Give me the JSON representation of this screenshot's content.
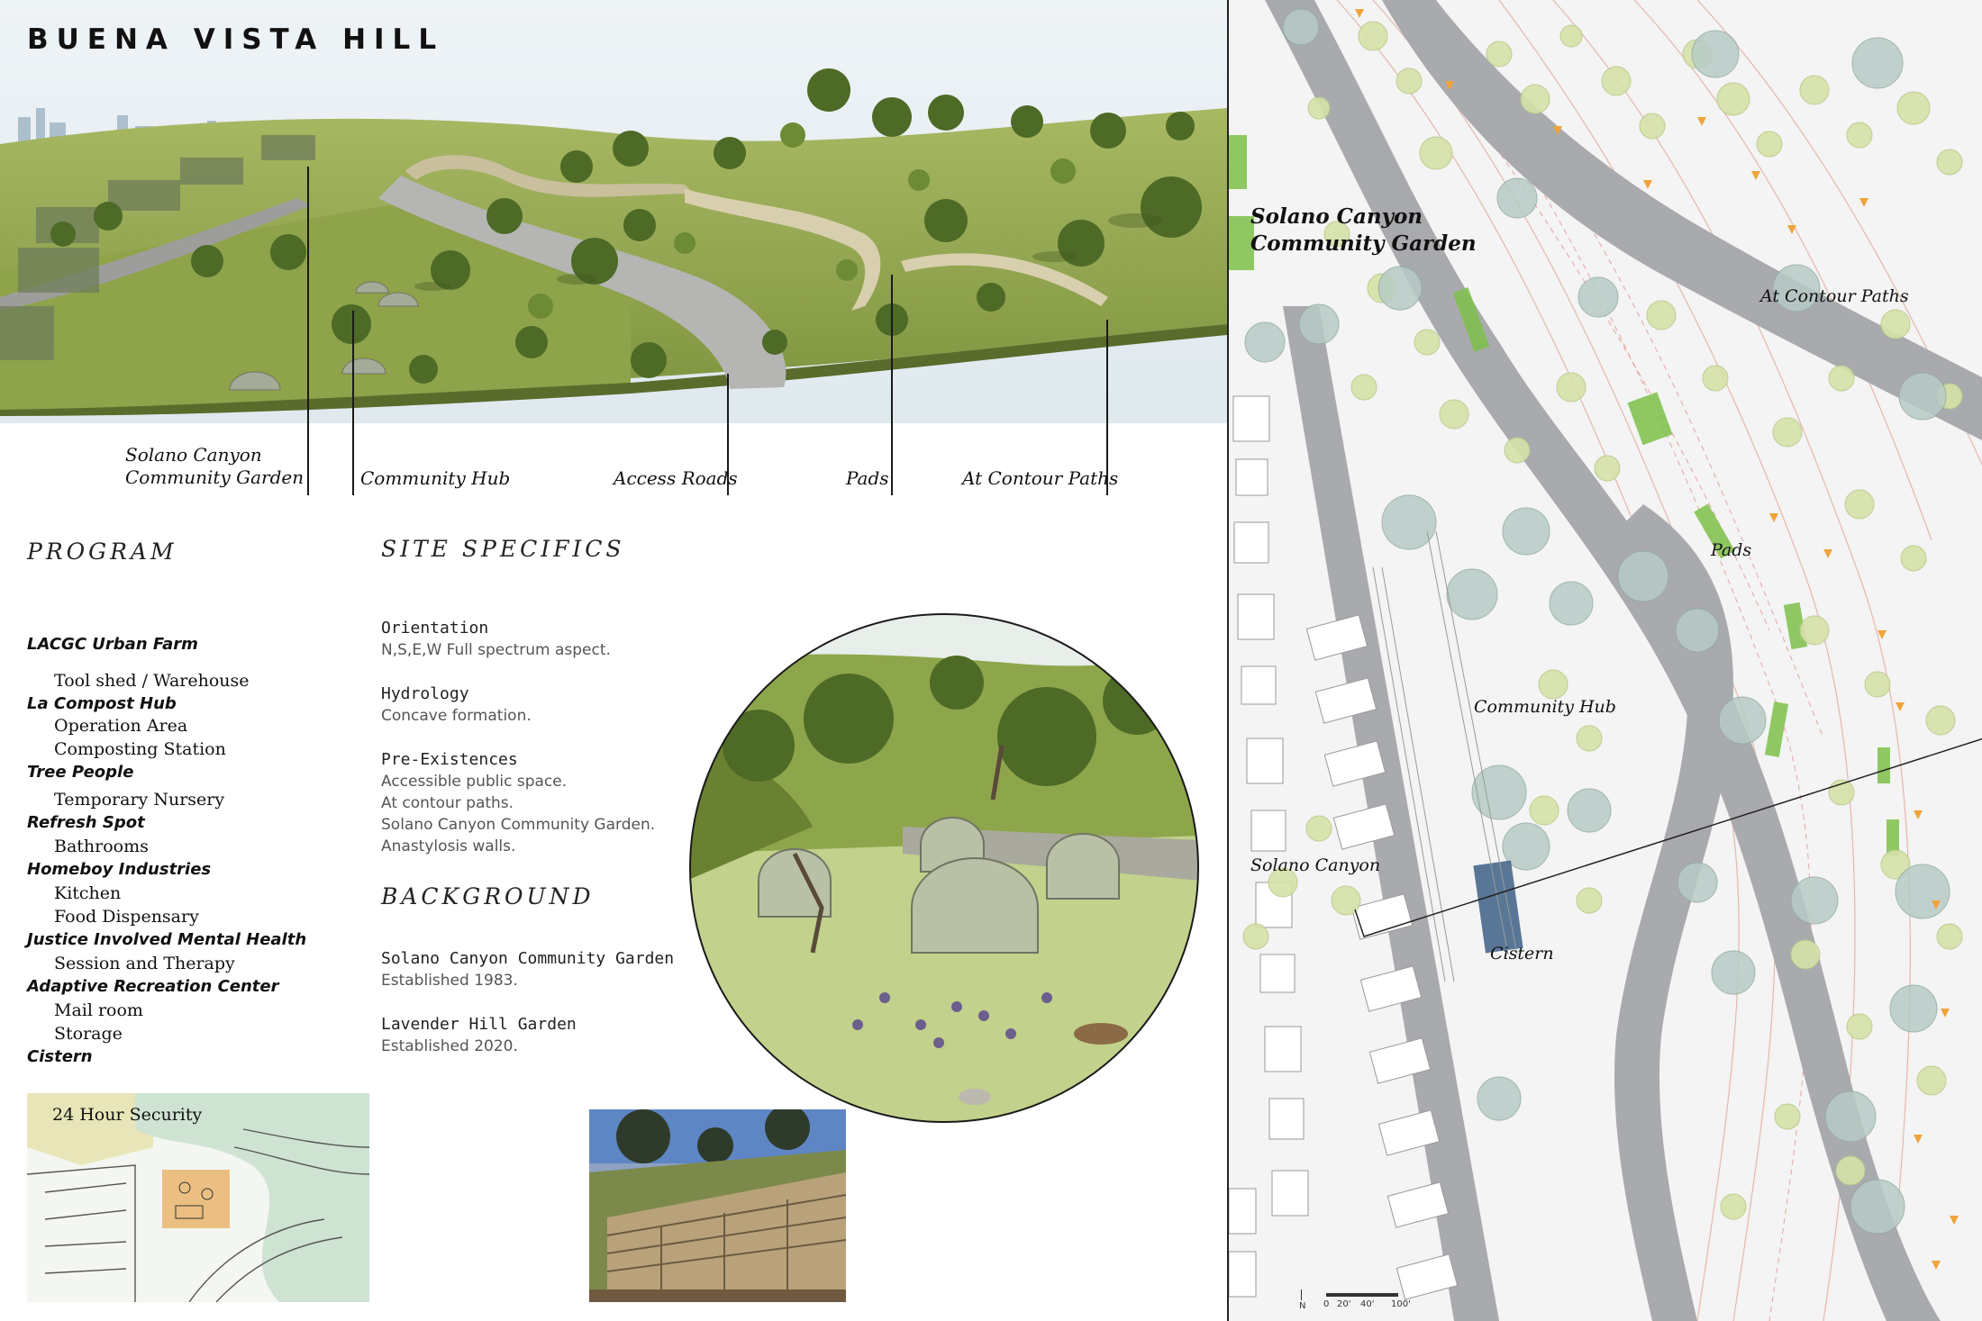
{
  "title": "BUENA VISTA HILL",
  "render_callouts": [
    {
      "label": "Solano Canyon\nCommunity Garden"
    },
    {
      "label": "Community Hub"
    },
    {
      "label": "Access Roads"
    },
    {
      "label": "Pads"
    },
    {
      "label": "At Contour Paths"
    }
  ],
  "program": {
    "heading": "PROGRAM",
    "groups": [
      {
        "name": "LACGC Urban Farm",
        "items": [
          "Tool shed / Warehouse"
        ]
      },
      {
        "name": "La Compost Hub",
        "items": [
          "Operation Area",
          "Composting Station"
        ]
      },
      {
        "name": "Tree People",
        "items": [
          "Temporary Nursery"
        ]
      },
      {
        "name": "Refresh Spot",
        "items": [
          "Bathrooms"
        ]
      },
      {
        "name": "Homeboy Industries",
        "items": [
          "Kitchen",
          "Food Dispensary"
        ]
      },
      {
        "name": "Justice Involved Mental Health",
        "items": [
          "Session and Therapy"
        ]
      },
      {
        "name": "Adaptive Recreation Center",
        "items": [
          "Mail room",
          "Storage"
        ]
      },
      {
        "name": "Cistern",
        "items": []
      }
    ]
  },
  "site_specifics": {
    "heading": "SITE SPECIFICS",
    "entries": [
      {
        "label": "Orientation",
        "lines": [
          "N,S,E,W Full spectrum aspect."
        ]
      },
      {
        "label": "Hydrology",
        "lines": [
          "Concave formation."
        ]
      },
      {
        "label": "Pre-Existences",
        "lines": [
          "Accessible public space.",
          "At contour paths.",
          "Solano Canyon Community Garden.",
          "Anastylosis walls."
        ]
      }
    ]
  },
  "background": {
    "heading": "BACKGROUND",
    "entries": [
      {
        "label": "Solano Canyon Community Garden",
        "lines": [
          "Established 1983."
        ]
      },
      {
        "label": "Lavender Hill Garden",
        "lines": [
          "Established 2020."
        ]
      }
    ]
  },
  "sketch_map": {
    "label": "24 Hour Security"
  },
  "map": {
    "labels": {
      "garden": "Solano Canyon\nCommunity Garden",
      "contour": "At Contour Paths",
      "pads": "Pads",
      "hub": "Community Hub",
      "canyon": "Solano Canyon",
      "cistern": "Cistern"
    },
    "north": "N",
    "scale": [
      "0",
      "20'",
      "40'",
      "100'"
    ]
  },
  "colors": {
    "grass": "#9caf52",
    "road": "#a9aaad",
    "tree_light": "#d5e2a8",
    "tree_blue": "#b7cbc6",
    "cistern": "#3d5f86",
    "pads": "#f0a43a",
    "garden_green": "#7ec04a"
  }
}
